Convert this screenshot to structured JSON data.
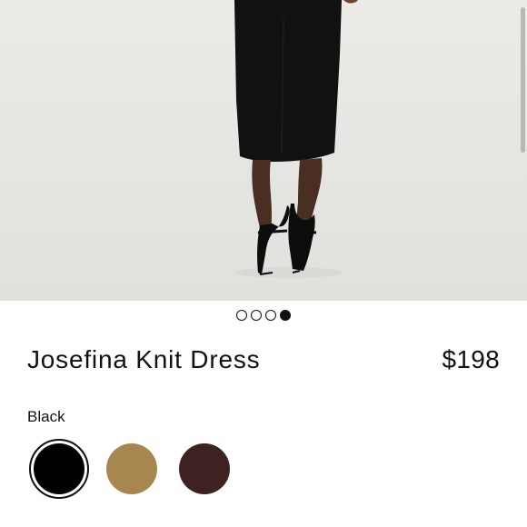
{
  "product": {
    "title": "Josefina Knit Dress",
    "price": "$198"
  },
  "gallery": {
    "image_count": 4,
    "active_index": 3,
    "image_alt": "model wearing black knit midi dress with black heels"
  },
  "colors": {
    "selected_name": "Black",
    "options": [
      {
        "name": "Black",
        "hex": "#000000",
        "selected": true
      },
      {
        "name": "Tan",
        "hex": "#a7864f",
        "selected": false
      },
      {
        "name": "Brown",
        "hex": "#3e2221",
        "selected": false
      }
    ]
  },
  "theme": {
    "background": "#ffffff",
    "text": "#111111",
    "photo_background": "#e6e5e1"
  }
}
